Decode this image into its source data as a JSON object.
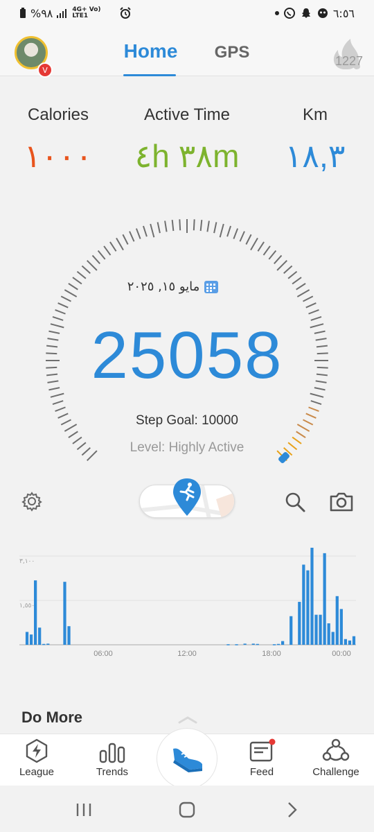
{
  "status_bar": {
    "battery": "%٩٨",
    "network": "4G+ Vo) LTE1",
    "time": "٦:٥٦"
  },
  "header": {
    "avatar_badge": "V",
    "tabs": [
      {
        "label": "Home",
        "active": true
      },
      {
        "label": "GPS",
        "active": false
      }
    ],
    "flame_count": "1227"
  },
  "stats": [
    {
      "label": "Calories",
      "value": "١٠٠٠",
      "color": "#e8541d"
    },
    {
      "label": "Active Time",
      "value": "٤h ٣٨m",
      "color": "#7db32e"
    },
    {
      "label": "Km",
      "value": "١٨,٣",
      "color": "#2d8ad8"
    }
  ],
  "gauge": {
    "date": "مايو ١٥, ٢٠٢٥",
    "steps": "25058",
    "step_goal": "Step Goal: 10000",
    "level": "Level: Highly Active",
    "progress": 1.0,
    "color": "#2d8ad8"
  },
  "chart_data": {
    "type": "bar",
    "yticks": [
      "٣,١٠٠",
      "١,٥٥٠"
    ],
    "xticks": [
      "06:00",
      "12:00",
      "18:00",
      "00:00"
    ],
    "ylim": [
      0,
      3100
    ],
    "values": [
      450,
      360,
      2250,
      600,
      30,
      40,
      0,
      0,
      0,
      2200,
      650,
      0,
      0,
      0,
      0,
      0,
      0,
      0,
      0,
      0,
      0,
      0,
      0,
      0,
      0,
      0,
      0,
      0,
      0,
      0,
      0,
      0,
      0,
      0,
      0,
      0,
      0,
      0,
      0,
      0,
      0,
      0,
      0,
      0,
      0,
      0,
      0,
      0,
      20,
      0,
      20,
      0,
      40,
      0,
      40,
      30,
      0,
      0,
      0,
      20,
      30,
      130,
      0,
      1000,
      0,
      1500,
      2800,
      2600,
      3400,
      1050,
      1050,
      3200,
      750,
      450,
      1700,
      1250,
      200,
      150,
      300
    ],
    "color": "#2d8ad8"
  },
  "tools": {
    "settings_icon": "gear-icon",
    "search_icon": "search-icon",
    "camera_icon": "camera-icon"
  },
  "section": {
    "title": "Do More"
  },
  "bottom_nav": [
    {
      "label": "League",
      "icon": "bolt-icon"
    },
    {
      "label": "Trends",
      "icon": "bars-icon"
    },
    {
      "label": "",
      "icon": "shoe-icon"
    },
    {
      "label": "Feed",
      "icon": "feed-icon"
    },
    {
      "label": "Challenge",
      "icon": "challenge-icon"
    }
  ]
}
